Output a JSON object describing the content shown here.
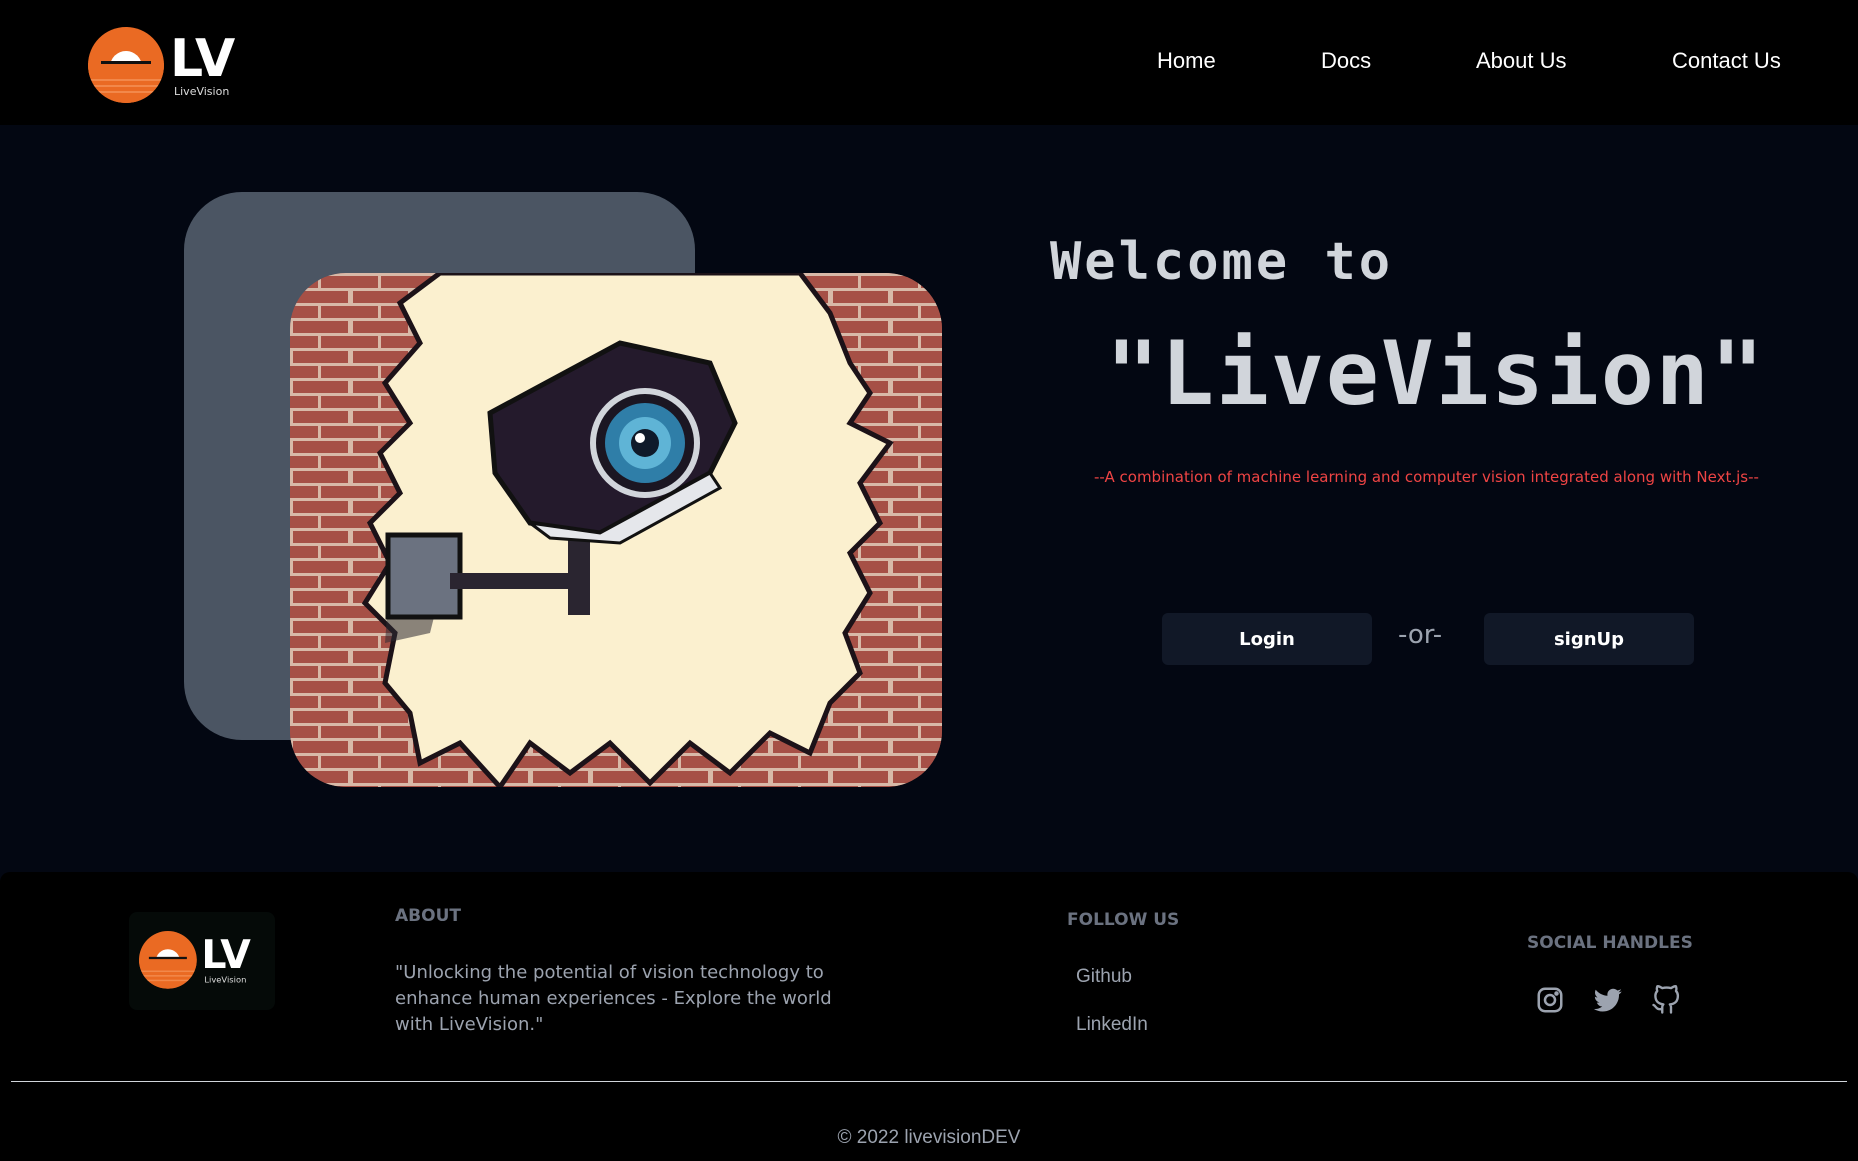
{
  "nav": {
    "logo": {
      "mark_text": "LV",
      "sub_text": "LiveVision"
    },
    "links": [
      "Home",
      "Docs",
      "About Us",
      "Contact Us"
    ]
  },
  "hero": {
    "welcome": "Welcome to",
    "title": "\"LiveVision\"",
    "tagline": "--A combination of machine learning and computer vision integrated along with Next.js--",
    "login_label": "Login",
    "or_label": "-or-",
    "signup_label": "signUp"
  },
  "footer": {
    "logo": {
      "mark_text": "LV",
      "sub_text": "LiveVision"
    },
    "about_heading": "ABOUT",
    "about_text": "\"Unlocking the potential of vision technology to enhance human experiences - Explore the world with LiveVision.\"",
    "follow_heading": "FOLLOW US",
    "follow_links": [
      "Github",
      "LinkedIn"
    ],
    "social_heading": "SOCIAL HANDLES",
    "social_icons": [
      "instagram-icon",
      "twitter-icon",
      "github-icon"
    ],
    "copyright": "© 2022 livevisionDEV"
  },
  "colors": {
    "background": "#030712",
    "nav_bg": "#000000",
    "accent_orange": "#ea6a23",
    "tagline_red": "#ef4444",
    "button_bg": "#111827",
    "card_back": "#4b5563"
  }
}
